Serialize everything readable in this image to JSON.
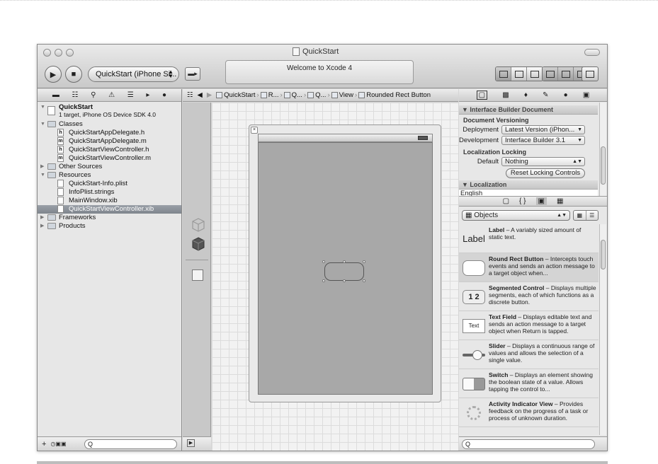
{
  "window": {
    "title": "QuickStart",
    "status_text": "Welcome to Xcode 4"
  },
  "toolbar": {
    "run_icon": "run-icon",
    "stop_icon": "stop-icon",
    "scheme": "QuickStart (iPhone Si...",
    "breakpoints_icon": "breakpoints-icon"
  },
  "navigator": {
    "tab_icons": [
      "folder-icon",
      "hierarchy-icon",
      "search-icon",
      "warning-icon",
      "list-icon",
      "breakpoint-icon",
      "log-icon"
    ],
    "project": {
      "name": "QuickStart",
      "subtitle": "1 target, iPhone OS Device SDK 4.0"
    },
    "items": [
      {
        "label": "Classes",
        "kind": "folder",
        "level": 1,
        "open": true
      },
      {
        "label": "QuickStartAppDelegate.h",
        "kind": "h",
        "level": 2
      },
      {
        "label": "QuickStartAppDelegate.m",
        "kind": "m",
        "level": 2
      },
      {
        "label": "QuickStartViewController.h",
        "kind": "h",
        "level": 2
      },
      {
        "label": "QuickStartViewController.m",
        "kind": "m",
        "level": 2
      },
      {
        "label": "Other Sources",
        "kind": "folder",
        "level": 1,
        "open": false
      },
      {
        "label": "Resources",
        "kind": "folder",
        "level": 1,
        "open": true
      },
      {
        "label": "QuickStart-Info.plist",
        "kind": "file",
        "level": 2
      },
      {
        "label": "InfoPlist.strings",
        "kind": "file",
        "level": 2
      },
      {
        "label": "MainWindow.xib",
        "kind": "xib",
        "level": 2
      },
      {
        "label": "QuickStartViewController.xib",
        "kind": "xib",
        "level": 2,
        "selected": true
      },
      {
        "label": "Frameworks",
        "kind": "folder",
        "level": 1,
        "open": false
      },
      {
        "label": "Products",
        "kind": "folder",
        "level": 1,
        "open": false
      }
    ],
    "footer_add": "+",
    "search_placeholder": "Q"
  },
  "jumpbar": {
    "crumbs": [
      "QuickStart",
      "R...",
      "Q...",
      "Q...",
      "View",
      "Rounded Rect Button"
    ]
  },
  "inspector": {
    "section_title": "Interface Builder Document",
    "versioning_title": "Document Versioning",
    "deployment_label": "Deployment",
    "deployment_value": "Latest Version (iPhon...",
    "development_label": "Development",
    "development_value": "Interface Builder 3.1",
    "locking_title": "Localization Locking",
    "default_label": "Default",
    "default_value": "Nothing",
    "reset_button": "Reset Locking Controls",
    "localization_title": "Localization",
    "localization_value": "English"
  },
  "library": {
    "selected_library": "Objects",
    "items": [
      {
        "thumb": "Label",
        "name": "Label",
        "desc": " – A variably sized amount of static text."
      },
      {
        "thumb": "",
        "name": "Round Rect Button",
        "desc": " – Intercepts touch events and sends an action message to a target object when...",
        "selected": true
      },
      {
        "thumb": "1 2",
        "name": "Segmented Control",
        "desc": " – Displays multiple segments, each of which functions as a discrete button."
      },
      {
        "thumb": "Text",
        "name": "Text Field",
        "desc": " – Displays editable text and sends an action message to a target object when Return is tapped."
      },
      {
        "thumb": "",
        "name": "Slider",
        "desc": " – Displays a continuous range of values and allows the selection of a single value."
      },
      {
        "thumb": "",
        "name": "Switch",
        "desc": " – Displays an element showing the boolean state of a value. Allows tapping the control to..."
      },
      {
        "thumb": "",
        "name": "Activity Indicator View",
        "desc": " – Provides feedback on the progress of a task or process of unknown duration."
      }
    ],
    "search_placeholder": "Q"
  }
}
